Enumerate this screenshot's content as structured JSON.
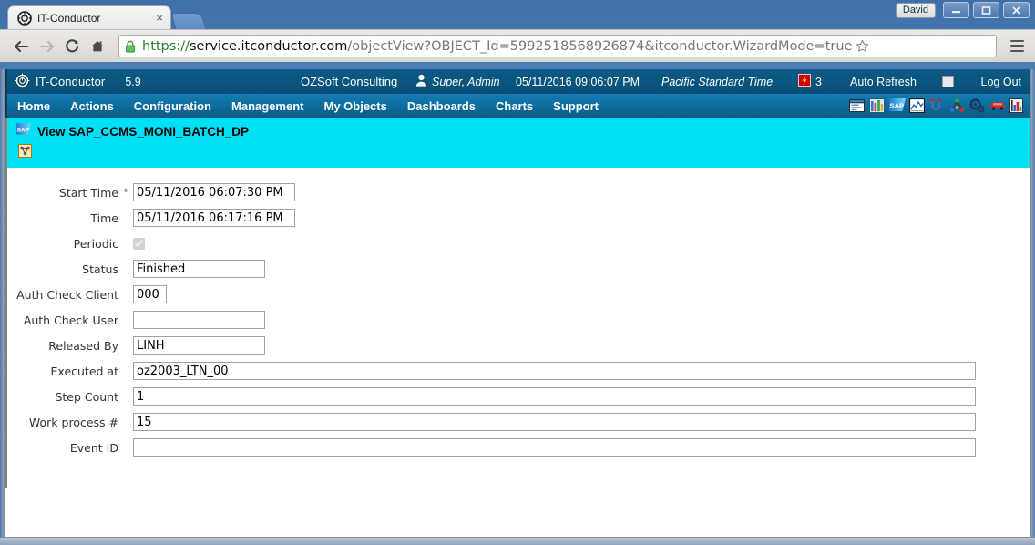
{
  "browser": {
    "tab": {
      "title": "IT-Conductor",
      "favicon": "gear-icon",
      "close_label": "×"
    },
    "new_tab_label": "",
    "profile_name": "David",
    "window_controls": {
      "minimize": "–",
      "maximize": "❐",
      "close": "✕"
    },
    "nav": {
      "back": "←",
      "forward": "→",
      "reload": "⟳",
      "home": "⌂"
    },
    "url": {
      "scheme": "https://",
      "host": "service.itconductor.com",
      "rest": "/objectView?OBJECT_Id=5992518568926874&itconductor.WizardMode=true",
      "full": "https://service.itconductor.com/objectView?OBJECT_Id=5992518568926874&itconductor.WizardMode=true",
      "secure": true,
      "lock_icon": "lock-icon"
    },
    "star_icon": "bookmark-star-icon",
    "menu_icon": "hamburger-menu-icon"
  },
  "app_header": {
    "logo_icon": "it-conductor-gear-logo",
    "brand": "IT-Conductor",
    "version": "5.9",
    "company": "OZSoft Consulting",
    "user_icon": "user-avatar-icon",
    "user_name": "Super, Admin",
    "datetime": "05/11/2016 09:06:07 PM",
    "timezone": "Pacific Standard Time",
    "alert_icon": "alert-red-icon",
    "alert_count": "3",
    "auto_refresh_label": "Auto Refresh",
    "auto_refresh_checked": false,
    "logout_label": "Log Out"
  },
  "nav": {
    "items": [
      {
        "label": "Home"
      },
      {
        "label": "Actions"
      },
      {
        "label": "Configuration"
      },
      {
        "label": "Management"
      },
      {
        "label": "My Objects"
      },
      {
        "label": "Dashboards"
      },
      {
        "label": "Charts"
      },
      {
        "label": "Support"
      }
    ],
    "tool_icons": [
      {
        "name": "window-form-icon"
      },
      {
        "name": "database-columns-icon"
      },
      {
        "name": "sap-icon"
      },
      {
        "name": "chart-monitor-icon"
      },
      {
        "name": "magnet-icon"
      },
      {
        "name": "topology-network-icon"
      },
      {
        "name": "gears-icon"
      },
      {
        "name": "car-icon"
      },
      {
        "name": "bar-chart-icon"
      }
    ]
  },
  "banner": {
    "icon": "sap-icon",
    "title": "View SAP_CCMS_MONI_BATCH_DP",
    "action_icon": "graph-action-icon"
  },
  "form": {
    "fields": [
      {
        "label": "Start Time",
        "required": true,
        "type": "text",
        "value": "05/11/2016 06:07:30 PM",
        "width_class": "w-date"
      },
      {
        "label": "Time",
        "required": false,
        "type": "text",
        "value": "05/11/2016 06:17:16 PM",
        "width_class": "w-date"
      },
      {
        "label": "Periodic",
        "required": false,
        "type": "checkbox",
        "value": "",
        "checked": true
      },
      {
        "label": "Status",
        "required": false,
        "type": "text",
        "value": "Finished",
        "width_class": "w-status"
      },
      {
        "label": "Auth Check Client",
        "required": false,
        "type": "text",
        "value": "000",
        "width_class": "w-client"
      },
      {
        "label": "Auth Check User",
        "required": false,
        "type": "text",
        "value": "",
        "width_class": "w-user"
      },
      {
        "label": "Released By",
        "required": false,
        "type": "text",
        "value": "LINH",
        "width_class": "w-released"
      },
      {
        "label": "Executed at",
        "required": false,
        "type": "text",
        "value": "oz2003_LTN_00",
        "width_class": "w-wide"
      },
      {
        "label": "Step Count",
        "required": false,
        "type": "text",
        "value": "1",
        "width_class": "w-wide"
      },
      {
        "label": "Work process #",
        "required": false,
        "type": "text",
        "value": "15",
        "width_class": "w-wide"
      },
      {
        "label": "Event ID",
        "required": false,
        "type": "text",
        "value": "",
        "width_class": "w-wide"
      }
    ],
    "required_marker": "*"
  },
  "colors": {
    "header_blue": "#0a567f",
    "nav_blue": "#0e6f9f",
    "banner_cyan": "#00e0f5",
    "alert_red": "#cc0000",
    "chrome_blue": "#4a7ab0"
  }
}
